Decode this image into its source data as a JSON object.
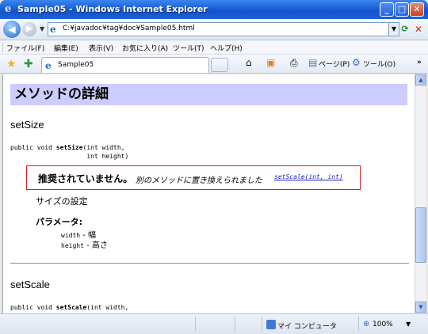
{
  "window": {
    "title": "Sample05 - Windows Internet Explorer",
    "address": "C:¥javadoc¥tag¥doc¥Sample05.html"
  },
  "menubar": [
    "ファイル(F)",
    "編集(E)",
    "表示(V)",
    "お気に入り(A)",
    "ツール(T)",
    "ヘルプ(H)"
  ],
  "favbar": {
    "tab_label": "Sample05",
    "commands": [
      "ページ(P)",
      "ツール(O)"
    ],
    "overflow": "»"
  },
  "page": {
    "section_title": "メソッドの詳細",
    "methods": [
      {
        "name": "setSize",
        "signature_prefix": "public void ",
        "signature_name": "setSize",
        "signature_args1": "(int width,",
        "signature_args2": "                    int height)",
        "deprecated_label": "推奨されていません。",
        "deprecated_text": "別のメソッドに置き換えられました",
        "deprecated_link": "setScale(int, int)",
        "description": "サイズの設定",
        "params_label": "パラメータ:",
        "params": [
          {
            "name": "width",
            "desc": " - 幅"
          },
          {
            "name": "height",
            "desc": " - 高さ"
          }
        ]
      },
      {
        "name": "setScale",
        "signature_prefix": "public void ",
        "signature_name": "setScale",
        "signature_args1": "(int width,"
      }
    ]
  },
  "statusbar": {
    "zone": "マイ コンピュータ",
    "zoom": "100%"
  }
}
